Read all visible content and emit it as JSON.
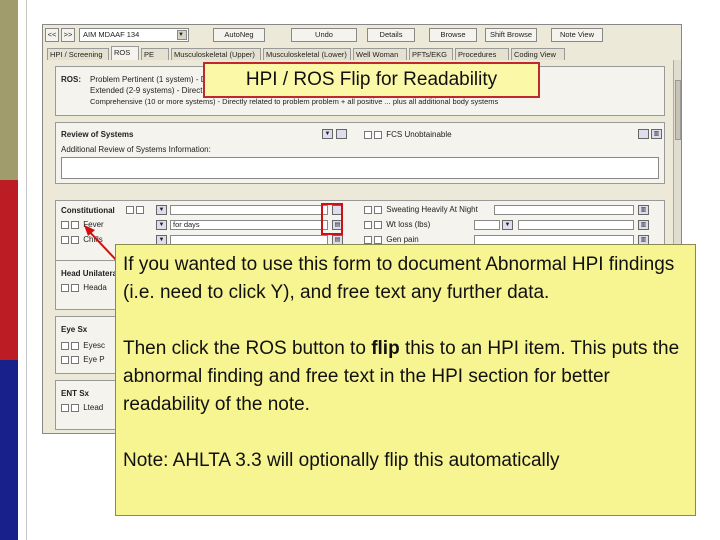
{
  "toolbar": {
    "nav_left": "<<",
    "nav_right": ">>",
    "form_select": "AIM MDAAF 134",
    "autoneg": "AutoNeg",
    "undo": "Undo",
    "details": "Details",
    "browse": "Browse",
    "shift_browse": "Shift Browse",
    "note_view": "Note View"
  },
  "tabs": [
    "HPI / Screening",
    "ROS",
    "PE",
    "Musculoskeletal (Upper)",
    "Musculoskeletal (Lower)",
    "Well Woman",
    "PFTs/EKG",
    "Procedures",
    "Coding View"
  ],
  "ros": {
    "label": "ROS:",
    "line1": "Problem Pertinent (1 system) - D",
    "line2": "Extended (2-9 systems) - Direct",
    "line3": "Comprehensive (10 or more systems) - Directly related to problem problem + all positive ... plus all additional body systems"
  },
  "review": {
    "title": "Review of Systems",
    "fcs": "FCS Unobtainable",
    "additional": "Additional Review of Systems Information:"
  },
  "constitutional": {
    "title": "Constitutional",
    "yes": "Y",
    "no": "N",
    "fever": "Fever",
    "fever_value": "for   days",
    "chills": "Chills",
    "sweating": "Sweating Heavily At Night",
    "wt_loss": "Wt loss (lbs)",
    "gen_pain": "Gen pain"
  },
  "sections": {
    "head": "Head Unilateral",
    "head_item": "Heada",
    "eye": "Eye Sx",
    "eye_item1": "Eyesc",
    "eye_item2": "Eye P",
    "ent": "ENT Sx",
    "ent_item": "Ltead"
  },
  "callout": {
    "title": "HPI / ROS Flip for Readability",
    "p1": "If you wanted to use this form to document Abnormal HPI findings (i.e. need to click Y), and free text any further data.",
    "p2_before": "Then click the ROS button to ",
    "p2_bold": "flip",
    "p2_after": " this to an HPI item. This puts the abnormal finding and free text in the HPI section for better readability of the note.",
    "p3": "Note: AHLTA 3.3 will optionally flip this automatically"
  },
  "colors": {
    "strip_top": "#a09c6c",
    "strip_mid": "#bc1c24",
    "strip_bottom": "#18208c",
    "callout_bg": "#f7f492",
    "highlight": "#d01010"
  }
}
